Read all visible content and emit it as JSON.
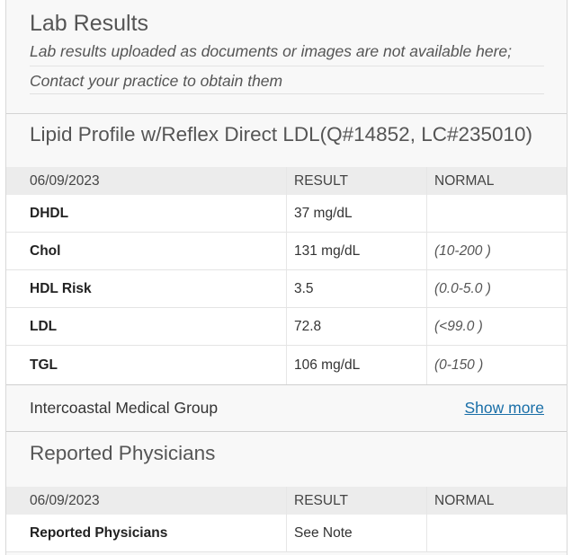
{
  "header": {
    "title": "Lab Results",
    "note_line1": "Lab results uploaded as documents or images are not available here;",
    "note_line2": "Contact your practice to obtain them"
  },
  "lipid": {
    "title": "Lipid Profile w/Reflex Direct LDL(Q#14852, LC#235010)",
    "columns": [
      "06/09/2023",
      "RESULT",
      "NORMAL"
    ],
    "rows": [
      {
        "name": "DHDL",
        "result": "37 mg/dL",
        "normal": ""
      },
      {
        "name": "Chol",
        "result": "131 mg/dL",
        "normal": "(10-200 )"
      },
      {
        "name": "HDL Risk",
        "result": "3.5",
        "normal": "(0.0-5.0 )"
      },
      {
        "name": "LDL",
        "result": "72.8",
        "normal": "(<99.0 )"
      },
      {
        "name": "TGL",
        "result": "106 mg/dL",
        "normal": "(0-150 )"
      }
    ],
    "organization": "Intercoastal Medical Group",
    "show_more_label": "Show more"
  },
  "physicians": {
    "title": "Reported Physicians",
    "columns": [
      "06/09/2023",
      "RESULT",
      "NORMAL"
    ],
    "rows": [
      {
        "name": "Reported Physicians",
        "result": "See Note",
        "normal": ""
      }
    ]
  },
  "colors": {
    "link": "#1a6fa8",
    "panel_background": "#f8f8f8",
    "table_header_background": "#ececec"
  }
}
